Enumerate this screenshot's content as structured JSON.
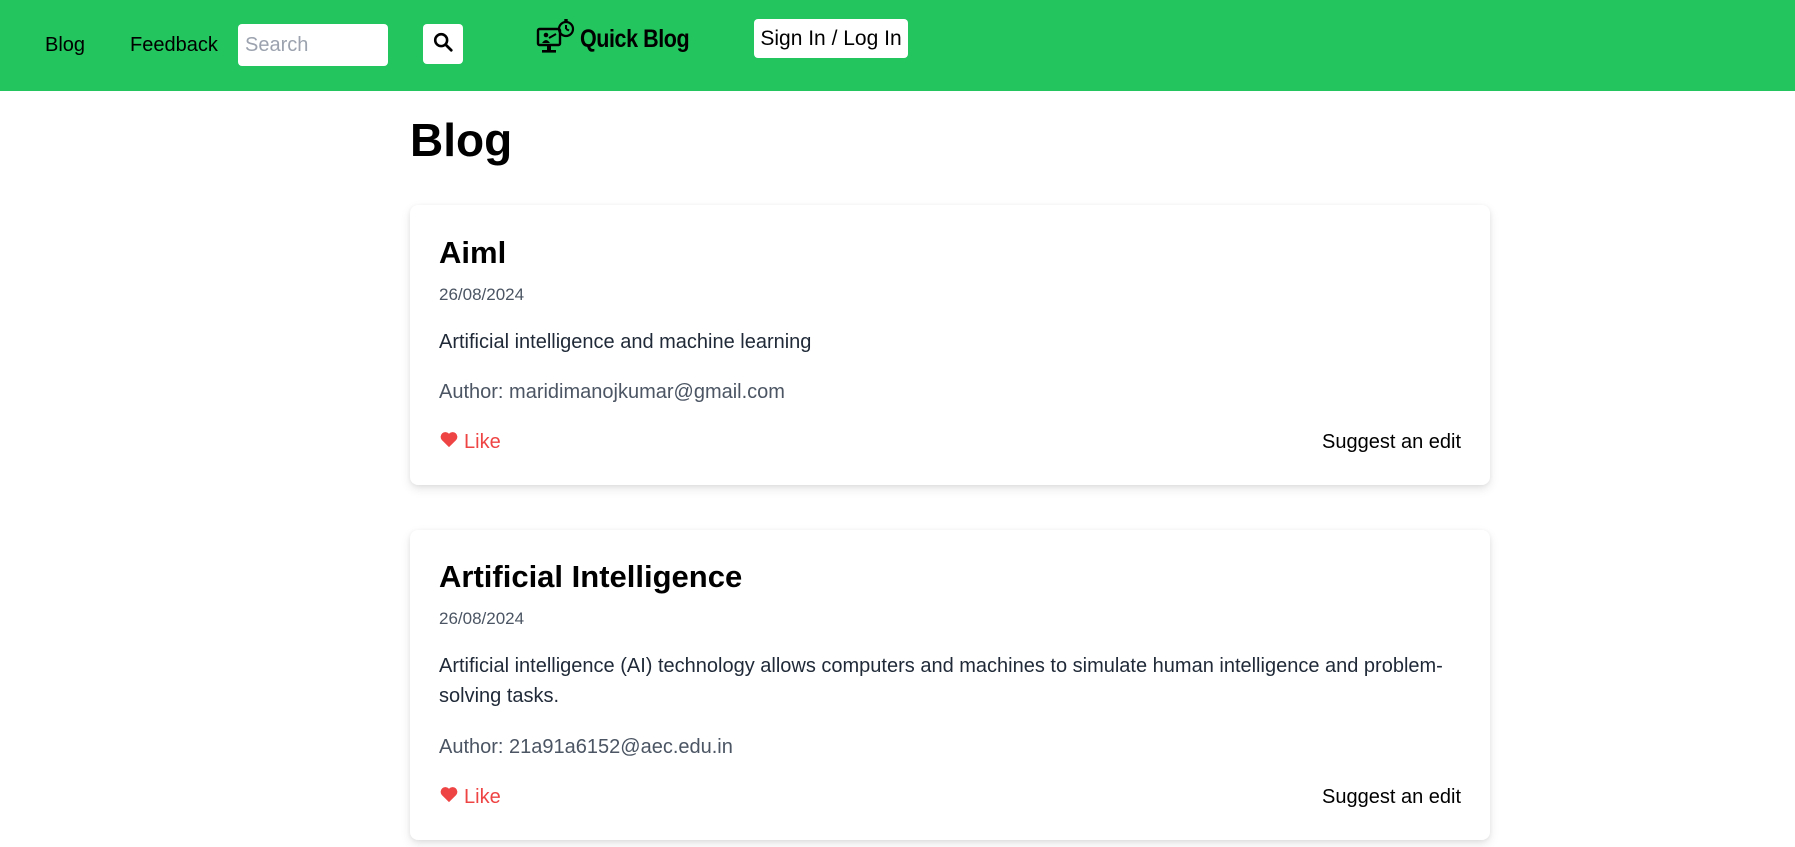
{
  "nav": {
    "blog_label": "Blog",
    "feedback_label": "Feedback",
    "search_placeholder": "Search",
    "search_value": "",
    "brand_name": "Quick Blog",
    "signin_label": "Sign In / Log In",
    "bg_color": "#22c55e"
  },
  "page": {
    "title": "Blog"
  },
  "posts": [
    {
      "title": "Aiml",
      "date": "26/08/2024",
      "description": "Artificial intelligence and machine learning",
      "author": "Author: maridimanojkumar@gmail.com",
      "like_label": "Like",
      "suggest_label": "Suggest an edit"
    },
    {
      "title": "Artificial Intelligence",
      "date": "26/08/2024",
      "description": "Artificial intelligence (AI) technology allows computers and machines to simulate human intelligence and problem-solving tasks.",
      "author": "Author: 21a91a6152@aec.edu.in",
      "like_label": "Like",
      "suggest_label": "Suggest an edit"
    }
  ],
  "colors": {
    "like": "#ef4444",
    "muted": "#4b5563"
  },
  "icons": {
    "search": "search-icon",
    "brand": "blog-logo-icon",
    "like": "heart-icon"
  }
}
